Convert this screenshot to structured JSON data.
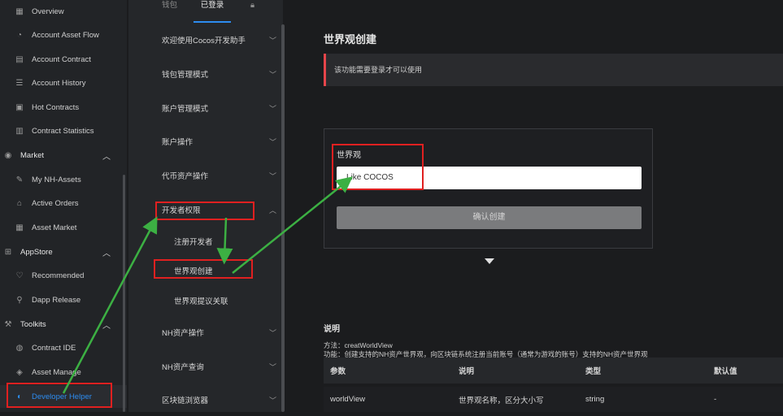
{
  "sidebar": {
    "items": [
      {
        "label": "Overview",
        "icon": "overview-icon",
        "type": "sub"
      },
      {
        "label": "Account Asset Flow",
        "icon": "asset-flow-icon",
        "type": "sub"
      },
      {
        "label": "Account Contract",
        "icon": "contract-icon",
        "type": "sub"
      },
      {
        "label": "Account History",
        "icon": "history-icon",
        "type": "sub"
      },
      {
        "label": "Hot Contracts",
        "icon": "hot-contracts-icon",
        "type": "sub"
      },
      {
        "label": "Contract Statistics",
        "icon": "statistics-icon",
        "type": "sub"
      },
      {
        "label": "Market",
        "icon": "market-icon",
        "type": "section"
      },
      {
        "label": "My NH-Assets",
        "icon": "nh-assets-icon",
        "type": "sub"
      },
      {
        "label": "Active Orders",
        "icon": "orders-icon",
        "type": "sub"
      },
      {
        "label": "Asset Market",
        "icon": "asset-market-icon",
        "type": "sub"
      },
      {
        "label": "AppStore",
        "icon": "appstore-icon",
        "type": "section"
      },
      {
        "label": "Recommended",
        "icon": "heart-icon",
        "type": "sub"
      },
      {
        "label": "Dapp Release",
        "icon": "release-icon",
        "type": "sub"
      },
      {
        "label": "Toolkits",
        "icon": "toolkits-icon",
        "type": "section"
      },
      {
        "label": "Contract IDE",
        "icon": "ide-icon",
        "type": "sub"
      },
      {
        "label": "Asset Manage",
        "icon": "asset-manage-icon",
        "type": "sub"
      },
      {
        "label": "Developer Helper",
        "icon": "developer-icon",
        "type": "sub"
      }
    ]
  },
  "tabs": {
    "wallet": "钱包",
    "logged_in": "已登录"
  },
  "menu": {
    "items": [
      "欢迎使用Cocos开发助手",
      "钱包管理模式",
      "账户管理模式",
      "账户操作",
      "代币资产操作",
      "开发者权限",
      "注册开发者",
      "世界观创建",
      "世界观提议关联",
      "NH资产操作",
      "NH资产查询",
      "区块链浏览器"
    ]
  },
  "main": {
    "title": "世界观创建",
    "alert": "该功能需要登录才可以使用",
    "form": {
      "label": "世界观",
      "value": "Like COCOS",
      "button": "确认创建"
    },
    "desc": {
      "heading": "说明",
      "method": "方法：creatWorldView",
      "function": "功能：创建支持的NH资产世界观，向区块链系统注册当前账号（通常为游戏的账号）支持的NH资产世界观"
    },
    "table": {
      "headers": [
        "参数",
        "说明",
        "类型",
        "默认值"
      ],
      "rows": [
        [
          "worldView",
          "世界观名称，区分大小写",
          "string",
          "-"
        ]
      ]
    }
  },
  "colors": {
    "accent": "#2d8cf0",
    "highlight": "#e02020",
    "arrow": "#3cb043"
  }
}
